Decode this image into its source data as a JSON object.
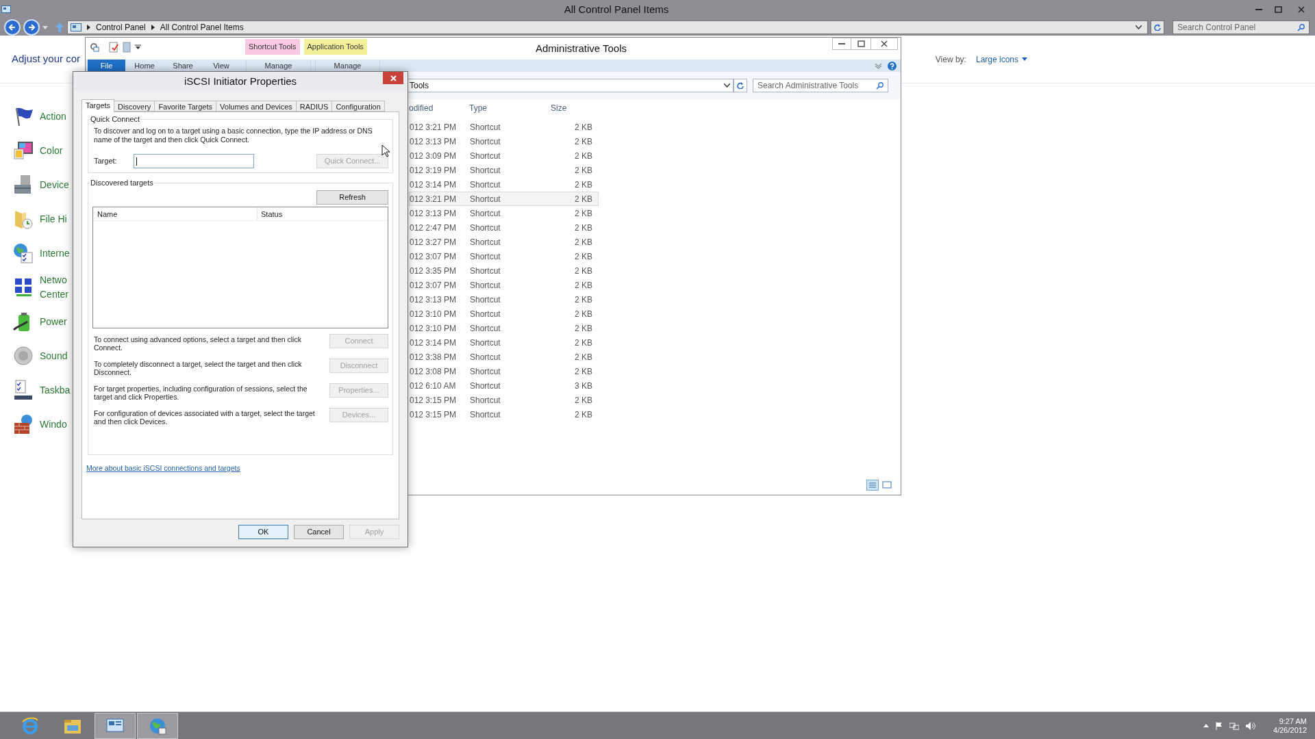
{
  "control_panel": {
    "title": "All Control Panel Items",
    "breadcrumb": [
      "Control Panel",
      "All Control Panel Items"
    ],
    "search": {
      "placeholder": "Search Control Panel"
    },
    "heading": "Adjust your cor",
    "view_by": {
      "label": "View by:",
      "value": "Large icons"
    },
    "items": [
      {
        "lines": [
          "Action"
        ]
      },
      {
        "lines": [
          "Color"
        ]
      },
      {
        "lines": [
          "Device"
        ]
      },
      {
        "lines": [
          "File Hi"
        ]
      },
      {
        "lines": [
          "Interne"
        ]
      },
      {
        "lines": [
          "Netwo",
          "Center"
        ]
      },
      {
        "lines": [
          "Power"
        ]
      },
      {
        "lines": [
          "Sound"
        ]
      },
      {
        "lines": [
          "Taskba"
        ]
      },
      {
        "lines": [
          "Windo"
        ]
      }
    ]
  },
  "explorer": {
    "title": "Administrative Tools",
    "contextual_tabs": [
      {
        "label": "Shortcut Tools",
        "color": "#f9c8e2",
        "tab": "Manage"
      },
      {
        "label": "Application Tools",
        "color": "#f3f09a",
        "tab": "Manage"
      }
    ],
    "ribbon_tabs": [
      {
        "label": "File",
        "kind": "file"
      },
      {
        "label": "Home",
        "kind": "tab"
      },
      {
        "label": "Share",
        "kind": "tab"
      },
      {
        "label": "View",
        "kind": "tab"
      }
    ],
    "address": "Tools",
    "search": {
      "placeholder": "Search Administrative Tools"
    },
    "columns": [
      "odified",
      "Type",
      "Size"
    ],
    "rows": [
      {
        "modified": "012 3:21 PM",
        "type": "Shortcut",
        "size": "2 KB",
        "selected": false
      },
      {
        "modified": "012 3:13 PM",
        "type": "Shortcut",
        "size": "2 KB",
        "selected": false
      },
      {
        "modified": "012 3:09 PM",
        "type": "Shortcut",
        "size": "2 KB",
        "selected": false
      },
      {
        "modified": "012 3:19 PM",
        "type": "Shortcut",
        "size": "2 KB",
        "selected": false
      },
      {
        "modified": "012 3:14 PM",
        "type": "Shortcut",
        "size": "2 KB",
        "selected": false
      },
      {
        "modified": "012 3:21 PM",
        "type": "Shortcut",
        "size": "2 KB",
        "selected": true
      },
      {
        "modified": "012 3:13 PM",
        "type": "Shortcut",
        "size": "2 KB",
        "selected": false
      },
      {
        "modified": "012 2:47 PM",
        "type": "Shortcut",
        "size": "2 KB",
        "selected": false
      },
      {
        "modified": "012 3:27 PM",
        "type": "Shortcut",
        "size": "2 KB",
        "selected": false
      },
      {
        "modified": "012 3:07 PM",
        "type": "Shortcut",
        "size": "2 KB",
        "selected": false
      },
      {
        "modified": "012 3:35 PM",
        "type": "Shortcut",
        "size": "2 KB",
        "selected": false
      },
      {
        "modified": "012 3:07 PM",
        "type": "Shortcut",
        "size": "2 KB",
        "selected": false
      },
      {
        "modified": "012 3:13 PM",
        "type": "Shortcut",
        "size": "2 KB",
        "selected": false
      },
      {
        "modified": "012 3:10 PM",
        "type": "Shortcut",
        "size": "2 KB",
        "selected": false
      },
      {
        "modified": "012 3:10 PM",
        "type": "Shortcut",
        "size": "2 KB",
        "selected": false
      },
      {
        "modified": "012 3:14 PM",
        "type": "Shortcut",
        "size": "2 KB",
        "selected": false
      },
      {
        "modified": "012 3:38 PM",
        "type": "Shortcut",
        "size": "2 KB",
        "selected": false
      },
      {
        "modified": "012 3:08 PM",
        "type": "Shortcut",
        "size": "2 KB",
        "selected": false
      },
      {
        "modified": "012 6:10 AM",
        "type": "Shortcut",
        "size": "3 KB",
        "selected": false
      },
      {
        "modified": "012 3:15 PM",
        "type": "Shortcut",
        "size": "2 KB",
        "selected": false
      },
      {
        "modified": "012 3:15 PM",
        "type": "Shortcut",
        "size": "2 KB",
        "selected": false
      }
    ]
  },
  "dialog": {
    "title": "iSCSI Initiator Properties",
    "tabs": [
      {
        "label": "Targets",
        "selected": true
      },
      {
        "label": "Discovery",
        "selected": false
      },
      {
        "label": "Favorite Targets",
        "selected": false
      },
      {
        "label": "Volumes and Devices",
        "selected": false
      },
      {
        "label": "RADIUS",
        "selected": false
      },
      {
        "label": "Configuration",
        "selected": false
      }
    ],
    "quick_connect": {
      "label": "Quick Connect",
      "description": "To discover and log on to a target using a basic connection, type the IP address or DNS name of the target and then click Quick Connect.",
      "target_label": "Target:",
      "button": {
        "label": "Quick Connect...",
        "disabled": true
      }
    },
    "discovered": {
      "label": "Discovered targets",
      "refresh": {
        "label": "Refresh",
        "disabled": false
      },
      "columns": [
        "Name",
        "Status"
      ]
    },
    "actions": [
      {
        "text": "To connect using advanced options, select a target and then click Connect.",
        "button": {
          "label": "Connect",
          "disabled": true
        }
      },
      {
        "text": "To completely disconnect a target, select the target and then click Disconnect.",
        "button": {
          "label": "Disconnect",
          "disabled": true
        }
      },
      {
        "text": "For target properties, including configuration of sessions, select the target and click Properties.",
        "button": {
          "label": "Properties...",
          "disabled": true
        }
      },
      {
        "text": "For configuration of devices associated with a target, select the target and then click Devices.",
        "button": {
          "label": "Devices...",
          "disabled": true
        }
      }
    ],
    "link": "More about basic iSCSI connections and targets",
    "buttons": [
      {
        "label": "OK",
        "disabled": false,
        "default": true
      },
      {
        "label": "Cancel",
        "disabled": false,
        "default": false
      },
      {
        "label": "Apply",
        "disabled": true,
        "default": false
      }
    ]
  },
  "taskbar": {
    "apps": [
      {
        "active": false
      },
      {
        "active": false
      },
      {
        "active": true
      },
      {
        "active": true
      }
    ],
    "time": "9:27 AM",
    "date": "4/26/2012"
  }
}
